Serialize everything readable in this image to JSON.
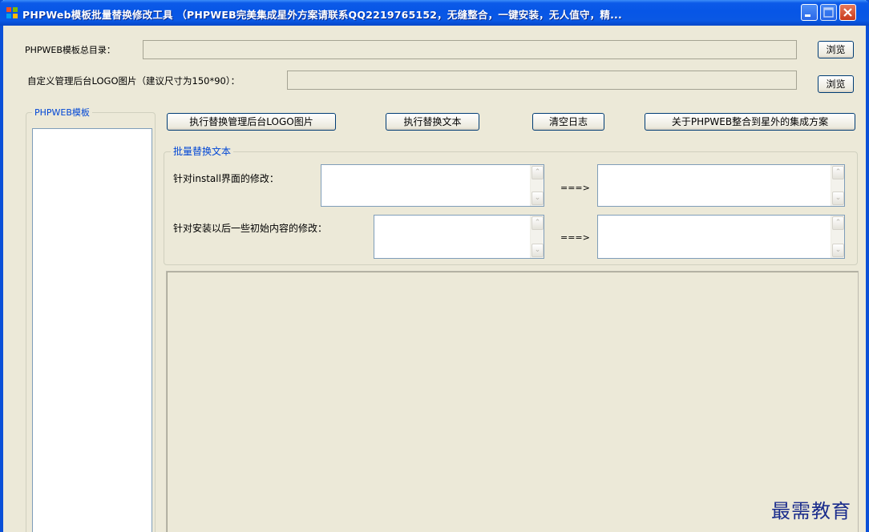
{
  "window": {
    "title": "PHPWeb模板批量替换修改工具 （PHPWEB完美集成星外方案请联系QQ2219765152，无缝整合，一键安装，无人值守，精..."
  },
  "paths": {
    "template_dir_label": "PHPWEB模板总目录：",
    "template_dir_value": "",
    "logo_label": "自定义管理后台LOGO图片（建议尺寸为150*90）：",
    "logo_value": "",
    "browse_label": "浏览"
  },
  "template_group": {
    "title": "PHPWEB模板",
    "items": []
  },
  "actions": {
    "replace_logo": "执行替换管理后台LOGO图片",
    "replace_text": "执行替换文本",
    "clear_log": "清空日志",
    "about": "关于PHPWEB整合到星外的集成方案"
  },
  "batch": {
    "title": "批量替换文本",
    "install_label": "针对install界面的修改：",
    "content_label": "针对安装以后一些初始内容的修改：",
    "arrow": "===>"
  },
  "log": {
    "text": ""
  },
  "watermark": "最需教育",
  "colors": {
    "titlebar": "#0756e6",
    "window_bg": "#ece9d8",
    "group_title": "#0046d5"
  }
}
